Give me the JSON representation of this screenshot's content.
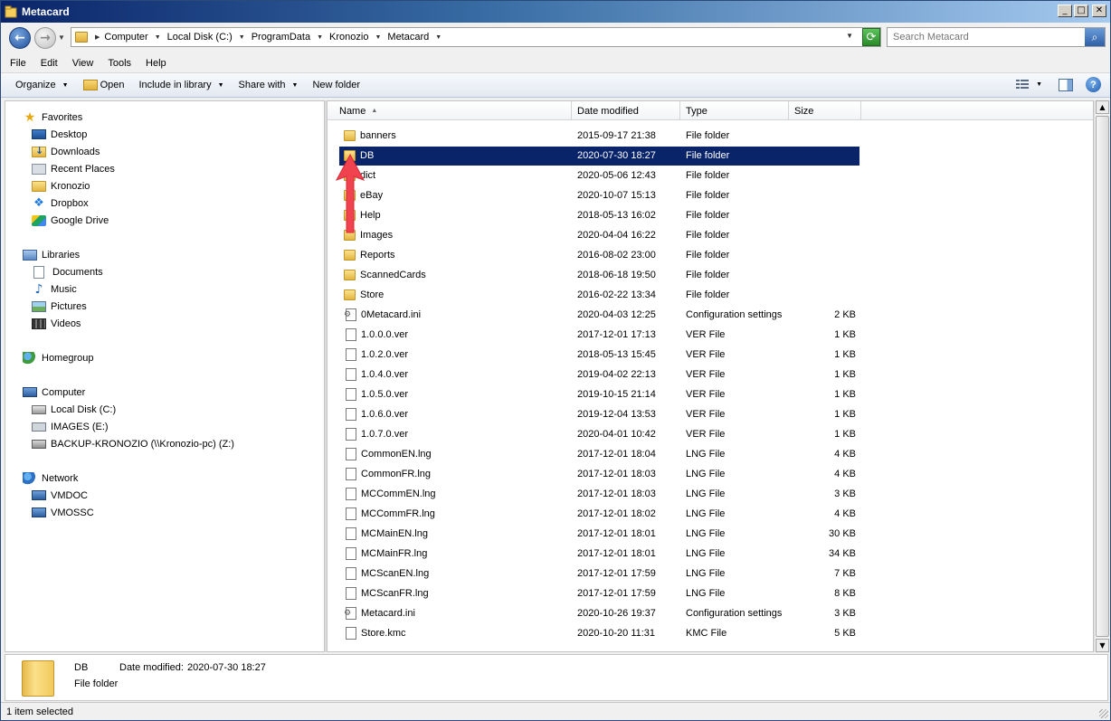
{
  "window": {
    "title": "Metacard"
  },
  "address": {
    "crumbs": [
      "Computer",
      "Local Disk (C:)",
      "ProgramData",
      "Kronozio",
      "Metacard"
    ]
  },
  "search": {
    "placeholder": "Search Metacard"
  },
  "menu": [
    "File",
    "Edit",
    "View",
    "Tools",
    "Help"
  ],
  "toolbar": {
    "organize": "Organize",
    "open": "Open",
    "include": "Include in library",
    "share": "Share with",
    "new_folder": "New folder"
  },
  "nav": {
    "favorites": {
      "label": "Favorites",
      "items": [
        {
          "label": "Desktop",
          "icon": "desktop-icon"
        },
        {
          "label": "Downloads",
          "icon": "downloads-icon"
        },
        {
          "label": "Recent Places",
          "icon": "recent-places-icon"
        },
        {
          "label": "Kronozio",
          "icon": "folder-icon"
        },
        {
          "label": "Dropbox",
          "icon": "dropbox-icon"
        },
        {
          "label": "Google Drive",
          "icon": "google-drive-icon"
        }
      ]
    },
    "libraries": {
      "label": "Libraries",
      "items": [
        {
          "label": "Documents",
          "icon": "documents-icon"
        },
        {
          "label": "Music",
          "icon": "music-icon"
        },
        {
          "label": "Pictures",
          "icon": "pictures-icon"
        },
        {
          "label": "Videos",
          "icon": "videos-icon"
        }
      ]
    },
    "homegroup": {
      "label": "Homegroup"
    },
    "computer": {
      "label": "Computer",
      "items": [
        {
          "label": "Local Disk (C:)",
          "icon": "local-disk-icon"
        },
        {
          "label": "IMAGES (E:)",
          "icon": "cd-drive-icon"
        },
        {
          "label": "BACKUP-KRONOZIO (\\\\Kronozio-pc) (Z:)",
          "icon": "network-drive-icon"
        }
      ]
    },
    "network": {
      "label": "Network",
      "items": [
        {
          "label": "VMDOC",
          "icon": "computer-icon"
        },
        {
          "label": "VMOSSC",
          "icon": "computer-icon"
        }
      ]
    }
  },
  "columns": {
    "name": "Name",
    "date": "Date modified",
    "type": "Type",
    "size": "Size"
  },
  "files": [
    {
      "name": "banners",
      "date": "2015-09-17 21:38",
      "type": "File folder",
      "size": "",
      "icon": "folder"
    },
    {
      "name": "DB",
      "date": "2020-07-30 18:27",
      "type": "File folder",
      "size": "",
      "icon": "folder"
    },
    {
      "name": "dict",
      "date": "2020-05-06 12:43",
      "type": "File folder",
      "size": "",
      "icon": "folder"
    },
    {
      "name": "eBay",
      "date": "2020-10-07 15:13",
      "type": "File folder",
      "size": "",
      "icon": "folder"
    },
    {
      "name": "Help",
      "date": "2018-05-13 16:02",
      "type": "File folder",
      "size": "",
      "icon": "folder"
    },
    {
      "name": "Images",
      "date": "2020-04-04 16:22",
      "type": "File folder",
      "size": "",
      "icon": "folder"
    },
    {
      "name": "Reports",
      "date": "2016-08-02 23:00",
      "type": "File folder",
      "size": "",
      "icon": "folder"
    },
    {
      "name": "ScannedCards",
      "date": "2018-06-18 19:50",
      "type": "File folder",
      "size": "",
      "icon": "folder"
    },
    {
      "name": "Store",
      "date": "2016-02-22 13:34",
      "type": "File folder",
      "size": "",
      "icon": "folder"
    },
    {
      "name": "0Metacard.ini",
      "date": "2020-04-03 12:25",
      "type": "Configuration settings",
      "size": "2 KB",
      "icon": "cfg"
    },
    {
      "name": "1.0.0.0.ver",
      "date": "2017-12-01 17:13",
      "type": "VER File",
      "size": "1 KB",
      "icon": "file"
    },
    {
      "name": "1.0.2.0.ver",
      "date": "2018-05-13 15:45",
      "type": "VER File",
      "size": "1 KB",
      "icon": "file"
    },
    {
      "name": "1.0.4.0.ver",
      "date": "2019-04-02 22:13",
      "type": "VER File",
      "size": "1 KB",
      "icon": "file"
    },
    {
      "name": "1.0.5.0.ver",
      "date": "2019-10-15 21:14",
      "type": "VER File",
      "size": "1 KB",
      "icon": "file"
    },
    {
      "name": "1.0.6.0.ver",
      "date": "2019-12-04 13:53",
      "type": "VER File",
      "size": "1 KB",
      "icon": "file"
    },
    {
      "name": "1.0.7.0.ver",
      "date": "2020-04-01 10:42",
      "type": "VER File",
      "size": "1 KB",
      "icon": "file"
    },
    {
      "name": "CommonEN.lng",
      "date": "2017-12-01 18:04",
      "type": "LNG File",
      "size": "4 KB",
      "icon": "file"
    },
    {
      "name": "CommonFR.lng",
      "date": "2017-12-01 18:03",
      "type": "LNG File",
      "size": "4 KB",
      "icon": "file"
    },
    {
      "name": "MCCommEN.lng",
      "date": "2017-12-01 18:03",
      "type": "LNG File",
      "size": "3 KB",
      "icon": "file"
    },
    {
      "name": "MCCommFR.lng",
      "date": "2017-12-01 18:02",
      "type": "LNG File",
      "size": "4 KB",
      "icon": "file"
    },
    {
      "name": "MCMainEN.lng",
      "date": "2017-12-01 18:01",
      "type": "LNG File",
      "size": "30 KB",
      "icon": "file"
    },
    {
      "name": "MCMainFR.lng",
      "date": "2017-12-01 18:01",
      "type": "LNG File",
      "size": "34 KB",
      "icon": "file"
    },
    {
      "name": "MCScanEN.lng",
      "date": "2017-12-01 17:59",
      "type": "LNG File",
      "size": "7 KB",
      "icon": "file"
    },
    {
      "name": "MCScanFR.lng",
      "date": "2017-12-01 17:59",
      "type": "LNG File",
      "size": "8 KB",
      "icon": "file"
    },
    {
      "name": "Metacard.ini",
      "date": "2020-10-26 19:37",
      "type": "Configuration settings",
      "size": "3 KB",
      "icon": "cfg"
    },
    {
      "name": "Store.kmc",
      "date": "2020-10-20 11:31",
      "type": "KMC File",
      "size": "5 KB",
      "icon": "file"
    }
  ],
  "selected_index": 1,
  "details": {
    "name": "DB",
    "date_label": "Date modified:",
    "date_value": "2020-07-30 18:27",
    "type": "File folder"
  },
  "status": {
    "text": "1 item selected"
  },
  "colors": {
    "selection": "#0a246a",
    "annotation_arrow": "#f0434f"
  }
}
